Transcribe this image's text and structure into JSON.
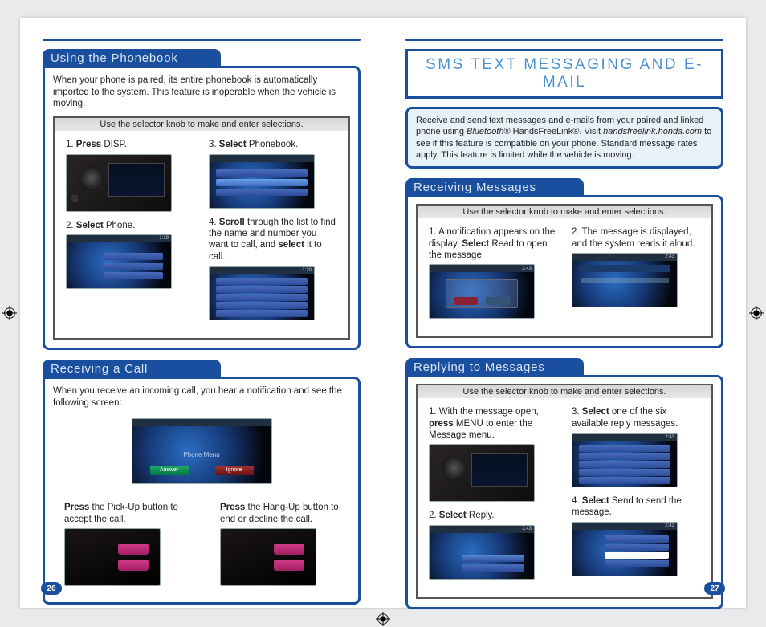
{
  "left_page": {
    "page_number": "26",
    "sections": {
      "phonebook": {
        "header": "Using the Phonebook",
        "intro": "When your phone is paired, its entire phonebook is automatically imported to the system. This feature is inoperable when the vehicle is moving.",
        "instruction_bar": "Use the selector knob to make and enter selections.",
        "steps": {
          "s1_idx": "1.",
          "s1_bold": "Press",
          "s1_rest": " DISP.",
          "s2_idx": "2.",
          "s2_bold": "Select",
          "s2_rest": " Phone.",
          "s3_idx": "3.",
          "s3_bold": "Select",
          "s3_rest": " Phonebook.",
          "s4_idx": "4.",
          "s4_bold": "Scroll",
          "s4_mid": " through the list to find the name and number you want to call, and ",
          "s4_bold2": "select",
          "s4_rest": " it to call."
        }
      },
      "receive_call": {
        "header": "Receiving a Call",
        "intro": "When you receive an incoming call, you hear a notification and see the following screen:",
        "pickup_bold": "Press",
        "pickup_rest": " the Pick-Up button to accept the call.",
        "hangup_bold": "Press",
        "hangup_rest": " the Hang-Up button to end or decline the call."
      }
    }
  },
  "right_page": {
    "page_number": "27",
    "title": "SMS TEXT MESSAGING AND E-MAIL",
    "callout_pre_italic": "Receive and send text messages and e-mails from your paired and linked phone using ",
    "callout_italic1": "Bluetooth",
    "callout_mid1": "® HandsFreeLink®. Visit ",
    "callout_italic2": "handsfreelink.honda.com",
    "callout_mid2": " to see if this feature is compatible on your phone. Standard message rates apply. This feature is limited while the vehicle is moving.",
    "sections": {
      "receiving": {
        "header": "Receiving Messages",
        "instruction_bar": "Use the selector knob to make and enter selections.",
        "s1_idx": "1.",
        "s1_pre": "A notification appears on the display. ",
        "s1_bold": "Select",
        "s1_post": " Read to open the message.",
        "s2_idx": "2.",
        "s2_text": "The message is displayed, and the system reads it aloud."
      },
      "replying": {
        "header": "Replying to Messages",
        "instruction_bar": "Use the selector knob to make and enter selections.",
        "s1_idx": "1.",
        "s1_pre": "With the message open, ",
        "s1_bold": "press",
        "s1_post": " MENU to enter the Message menu.",
        "s2_idx": "2.",
        "s2_bold": "Select",
        "s2_post": " Reply.",
        "s3_idx": "3.",
        "s3_bold": "Select",
        "s3_post": " one of the six available reply messages.",
        "s4_idx": "4.",
        "s4_bold": "Select",
        "s4_post": " Send to send the message."
      }
    }
  },
  "decor": {
    "time1": "1:19",
    "time2": "1:20",
    "time3": "2:43",
    "phone_menu": "Phone Menu",
    "answer": "Answer",
    "ignore": "Ignore"
  }
}
